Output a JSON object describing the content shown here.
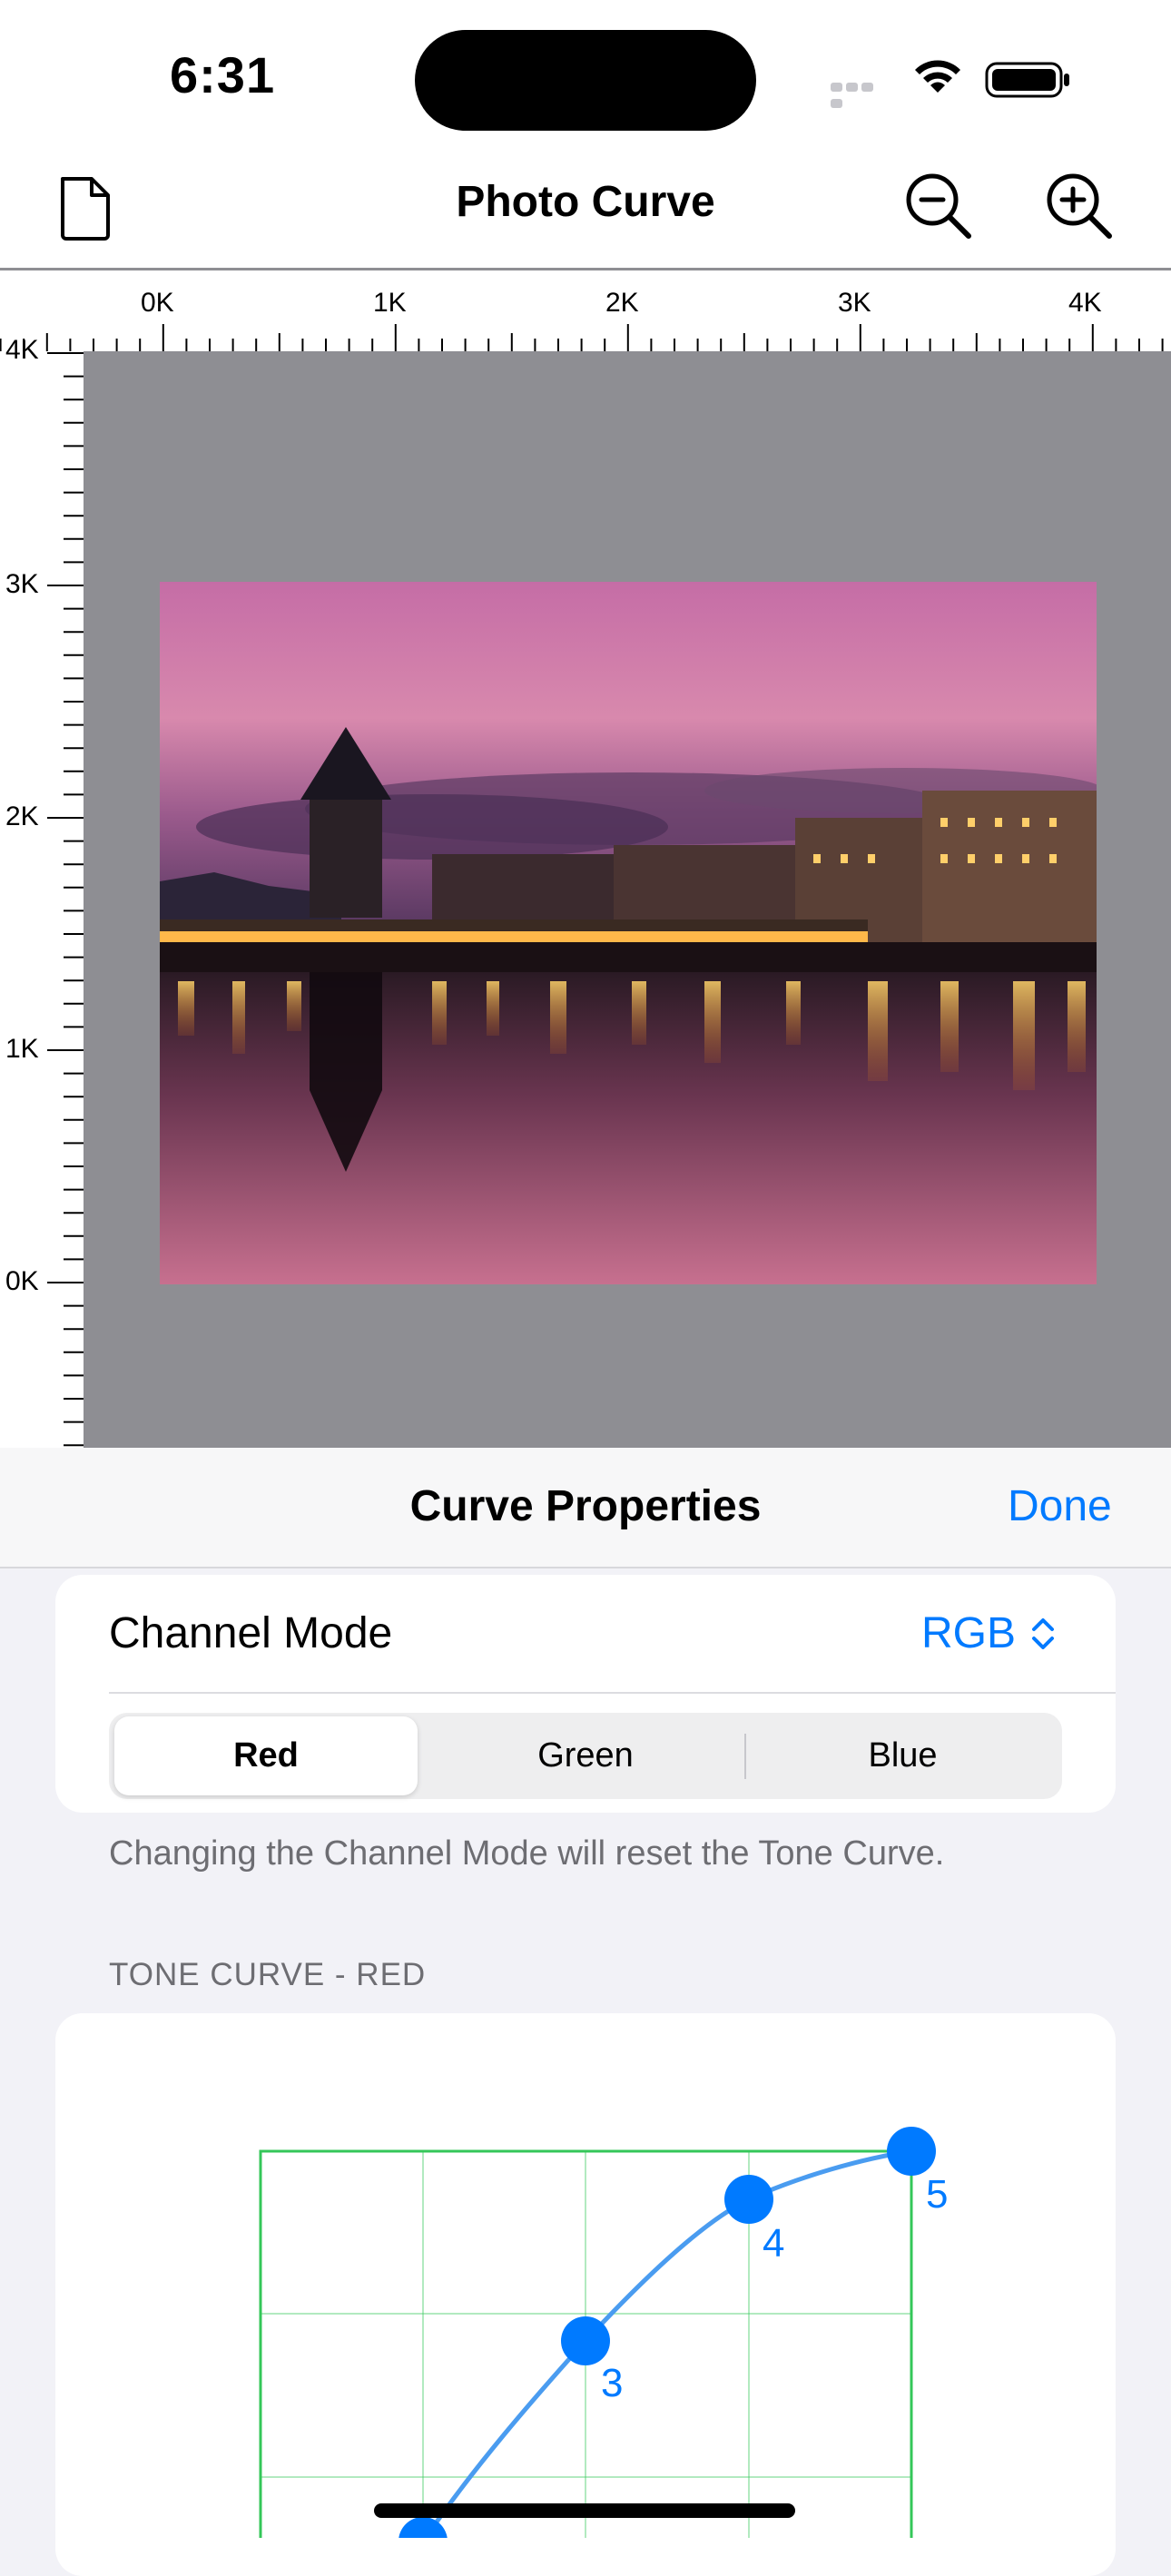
{
  "status_bar": {
    "time": "6:31"
  },
  "nav": {
    "title": "Photo Curve",
    "icons": [
      "document-icon",
      "zoom-out-icon",
      "zoom-in-icon"
    ]
  },
  "rulers": {
    "horizontal_labels": [
      "0K",
      "1K",
      "2K",
      "3K",
      "4K"
    ],
    "vertical_labels": [
      "4K",
      "3K",
      "2K",
      "1K",
      "0K"
    ]
  },
  "photo": {
    "description_icon": "photo-image"
  },
  "sheet": {
    "title": "Curve Properties",
    "done_label": "Done",
    "channel_mode_label": "Channel Mode",
    "channel_mode_value": "RGB",
    "segments": [
      "Red",
      "Green",
      "Blue"
    ],
    "selected_segment": "Red",
    "footer_note": "Changing the Channel Mode will reset the Tone Curve.",
    "tone_curve_header": "TONE CURVE - RED",
    "curve_points": [
      {
        "label": "3"
      },
      {
        "label": "4"
      },
      {
        "label": "5"
      }
    ]
  },
  "colors": {
    "accent": "#007aff",
    "grid": "#34c759",
    "canvas": "#8e8e93"
  }
}
